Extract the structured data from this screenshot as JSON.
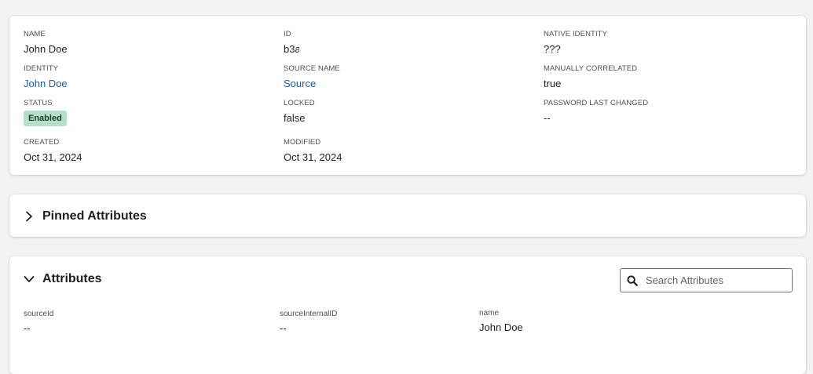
{
  "details": {
    "name": {
      "label": "NAME",
      "value": "John Doe"
    },
    "identity": {
      "label": "IDENTITY",
      "value": "John Doe"
    },
    "status": {
      "label": "STATUS",
      "value": "Enabled"
    },
    "created": {
      "label": "CREATED",
      "value": "Oct 31, 2024"
    },
    "id": {
      "label": "ID",
      "value": "b3a"
    },
    "source_name": {
      "label": "SOURCE NAME",
      "value": "Source"
    },
    "locked": {
      "label": "LOCKED",
      "value": "false"
    },
    "modified": {
      "label": "MODIFIED",
      "value": "Oct 31, 2024"
    },
    "native_identity": {
      "label": "NATIVE IDENTITY",
      "value": "???"
    },
    "manually_correlated": {
      "label": "MANUALLY CORRELATED",
      "value": "true"
    },
    "password_last_changed": {
      "label": "PASSWORD LAST CHANGED",
      "value": "--"
    }
  },
  "pinned": {
    "title": "Pinned Attributes",
    "icon": "chevron-right-icon"
  },
  "attributes": {
    "title": "Attributes",
    "icon": "chevron-down-icon",
    "search_placeholder": "Search Attributes",
    "search_icon": "search-icon",
    "items": [
      {
        "label": "sourceId",
        "value": "--"
      },
      {
        "label": "sourceInternalID",
        "value": "--"
      },
      {
        "label": "name",
        "value": "John Doe"
      }
    ]
  },
  "colors": {
    "link": "#1a5ea8",
    "badge_bg": "#b7dfc7",
    "page_bg": "#f1f3f6"
  }
}
